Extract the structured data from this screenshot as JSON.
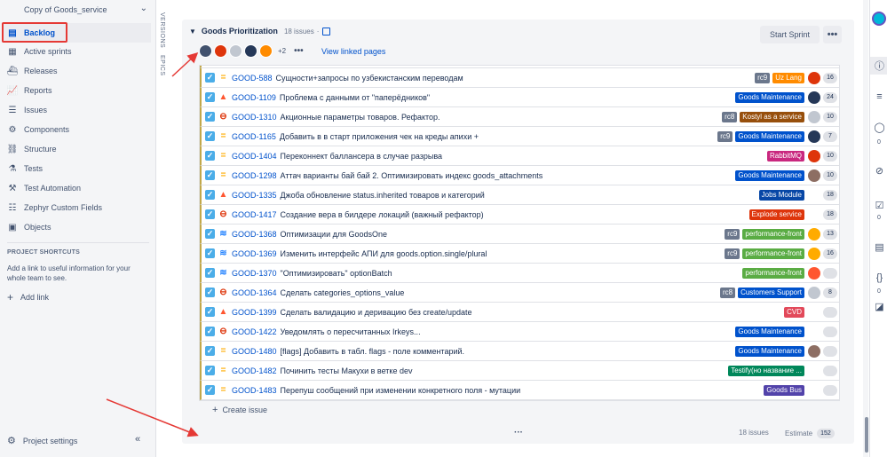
{
  "sidebar": {
    "project_name": "Copy of Goods_service",
    "items": [
      {
        "label": "Backlog",
        "icon": "backlog-icon",
        "glyph": "▤",
        "active": true
      },
      {
        "label": "Active sprints",
        "icon": "board-icon",
        "glyph": "▦",
        "active": false
      },
      {
        "label": "Releases",
        "icon": "ship-icon",
        "glyph": "⛴",
        "active": false
      },
      {
        "label": "Reports",
        "icon": "chart-icon",
        "glyph": "📈",
        "active": false
      },
      {
        "label": "Issues",
        "icon": "issues-icon",
        "glyph": "☰",
        "active": false
      },
      {
        "label": "Components",
        "icon": "components-icon",
        "glyph": "⚙",
        "active": false
      },
      {
        "label": "Structure",
        "icon": "structure-icon",
        "glyph": "⛓",
        "active": false
      },
      {
        "label": "Tests",
        "icon": "flask-icon",
        "glyph": "⚗",
        "active": false
      },
      {
        "label": "Test Automation",
        "icon": "automation-icon",
        "glyph": "⚒",
        "active": false
      },
      {
        "label": "Zephyr Custom Fields",
        "icon": "zephyr-icon",
        "glyph": "☷",
        "active": false
      },
      {
        "label": "Objects",
        "icon": "objects-icon",
        "glyph": "▣",
        "active": false
      }
    ],
    "shortcuts_title": "PROJECT SHORTCUTS",
    "shortcuts_help": "Add a link to useful information for your whole team to see.",
    "add_link": "Add link",
    "settings": "Project settings",
    "collapse": "«"
  },
  "vtabs": {
    "versions": "VERSIONS",
    "epics": "EPICS"
  },
  "sprint": {
    "title": "Goods Prioritization",
    "count": "18 issues",
    "separator": "·",
    "start_label": "Start Sprint",
    "more_label": "•••",
    "avatars_more": "+2",
    "avatars_dots": "•••",
    "linked_pages": "View linked pages",
    "create_issue": "Create issue",
    "footer_count": "18 issues",
    "footer_estimate_label": "Estimate",
    "footer_estimate_value": "152",
    "avatar_colors": [
      "#42526e",
      "#de350b",
      "#c1c7d0",
      "#253858",
      "#ff8b00"
    ]
  },
  "colors": {
    "rc": "#6b778c",
    "goods_maintenance": "#0052cc",
    "uz_lang": "#ff8b00",
    "kostyl": "#974f0c",
    "rabbitmq": "#c9287f",
    "jobs_module": "#0747a6",
    "explode_service": "#de350b",
    "performance_front": "#5aac44",
    "customers_support": "#0052cc",
    "cvd": "#e2495a",
    "testify": "#00875a",
    "goods_bus": "#5243aa"
  },
  "issues": [
    {
      "key": "GOOD-588",
      "summary": "Сущности+запросы по узбекистанским переводам",
      "prio": "medium",
      "prio_glyph": "=",
      "type": "story",
      "type_glyph": "✓",
      "labels": [
        {
          "text": "rc9",
          "rc": true
        },
        {
          "text": "Uz Lang",
          "color": "#ff8b00"
        }
      ],
      "avatar": "#de350b",
      "estimate": "16"
    },
    {
      "key": "GOOD-1109",
      "summary": "Проблема с данными от \"паперёдников\"",
      "prio": "highest",
      "prio_glyph": "▲",
      "type": "story",
      "type_glyph": "✓",
      "labels": [
        {
          "text": "Goods Maintenance",
          "color": "#0052cc"
        }
      ],
      "avatar": "#253858",
      "estimate": "24"
    },
    {
      "key": "GOOD-1310",
      "summary": "Акционные параметры товаров. Рефактор.",
      "prio": "blocker",
      "prio_glyph": "⊖",
      "type": "story",
      "type_glyph": "✓",
      "labels": [
        {
          "text": "rc8",
          "rc": true
        },
        {
          "text": "Kostyl as a service",
          "color": "#974f0c"
        }
      ],
      "avatar": "#c1c7d0",
      "estimate": "10"
    },
    {
      "key": "GOOD-1165",
      "summary": "Добавить в в старт приложения чек на креды апихи +",
      "prio": "medium",
      "prio_glyph": "=",
      "type": "story",
      "type_glyph": "✓",
      "labels": [
        {
          "text": "rc9",
          "rc": true
        },
        {
          "text": "Goods Maintenance",
          "color": "#0052cc"
        }
      ],
      "avatar": "#253858",
      "estimate": "7"
    },
    {
      "key": "GOOD-1404",
      "summary": "Переконнект баллансера в случае разрыва",
      "prio": "medium",
      "prio_glyph": "=",
      "type": "story",
      "type_glyph": "✓",
      "labels": [
        {
          "text": "RabbitMQ",
          "color": "#c9287f"
        }
      ],
      "avatar": "#de350b",
      "estimate": "10"
    },
    {
      "key": "GOOD-1298",
      "summary": "Аттач варианты бай бай 2. Оптимизировать индекс goods_attachments",
      "prio": "medium",
      "prio_glyph": "=",
      "type": "story",
      "type_glyph": "✓",
      "labels": [
        {
          "text": "Goods Maintenance",
          "color": "#0052cc"
        }
      ],
      "avatar": "#8d6e63",
      "estimate": "10"
    },
    {
      "key": "GOOD-1335",
      "summary": "Джоба обновление status.inherited товаров и категорий",
      "prio": "highest",
      "prio_glyph": "▲",
      "type": "story",
      "type_glyph": "✓",
      "labels": [
        {
          "text": "Jobs Module",
          "color": "#0747a6"
        }
      ],
      "avatar": "",
      "estimate": "18"
    },
    {
      "key": "GOOD-1417",
      "summary": "Создание вера в билдере локаций (важный рефактор)",
      "prio": "blocker",
      "prio_glyph": "⊖",
      "type": "story",
      "type_glyph": "✓",
      "labels": [
        {
          "text": "Explode service",
          "color": "#de350b"
        }
      ],
      "avatar": "",
      "estimate": "18"
    },
    {
      "key": "GOOD-1368",
      "summary": "Оптимизации для GoodsOne",
      "prio": "low",
      "prio_glyph": "≋",
      "type": "story",
      "type_glyph": "✓",
      "labels": [
        {
          "text": "rc9",
          "rc": true
        },
        {
          "text": "performance-front",
          "color": "#5aac44"
        }
      ],
      "avatar": "#ffab00",
      "estimate": "13"
    },
    {
      "key": "GOOD-1369",
      "summary": "Изменить интерфейс АПИ для goods.option.single/plural",
      "prio": "low",
      "prio_glyph": "≋",
      "type": "story",
      "type_glyph": "✓",
      "labels": [
        {
          "text": "rc9",
          "rc": true
        },
        {
          "text": "performance-front",
          "color": "#5aac44"
        }
      ],
      "avatar": "#ffab00",
      "estimate": "16"
    },
    {
      "key": "GOOD-1370",
      "summary": "\"Оптимизировать\" optionBatch",
      "prio": "low",
      "prio_glyph": "≋",
      "type": "story",
      "type_glyph": "✓",
      "labels": [
        {
          "text": "performance-front",
          "color": "#5aac44"
        }
      ],
      "avatar": "#ff5630",
      "estimate": ""
    },
    {
      "key": "GOOD-1364",
      "summary": "Сделать categories_options_value",
      "prio": "blocker",
      "prio_glyph": "⊖",
      "type": "story",
      "type_glyph": "✓",
      "labels": [
        {
          "text": "rc8",
          "rc": true
        },
        {
          "text": "Customers Support",
          "color": "#0052cc"
        }
      ],
      "avatar": "#c1c7d0",
      "estimate": "8"
    },
    {
      "key": "GOOD-1399",
      "summary": "Сделать валидацию и деривацию без create/update",
      "prio": "highest",
      "prio_glyph": "▲",
      "type": "story",
      "type_glyph": "✓",
      "labels": [
        {
          "text": "CVD",
          "color": "#e2495a"
        }
      ],
      "avatar": "",
      "estimate": ""
    },
    {
      "key": "GOOD-1422",
      "summary": "Уведомлять о пересчитанных Irkeys...",
      "prio": "blocker",
      "prio_glyph": "⊖",
      "type": "story",
      "type_glyph": "✓",
      "labels": [
        {
          "text": "Goods Maintenance",
          "color": "#0052cc"
        }
      ],
      "avatar": "",
      "estimate": ""
    },
    {
      "key": "GOOD-1480",
      "summary": "[flags] Добавить в табл. flags - поле комментарий.",
      "prio": "medium",
      "prio_glyph": "=",
      "type": "story",
      "type_glyph": "✓",
      "labels": [
        {
          "text": "Goods Maintenance",
          "color": "#0052cc"
        }
      ],
      "avatar": "#8d6e63",
      "estimate": ""
    },
    {
      "key": "GOOD-1482",
      "summary": "Починить тесты Макухи в ветке dev",
      "prio": "medium",
      "prio_glyph": "=",
      "type": "story",
      "type_glyph": "✓",
      "labels": [
        {
          "text": "Testify(но название ...",
          "color": "#00875a"
        }
      ],
      "avatar": "",
      "estimate": ""
    },
    {
      "key": "GOOD-1483",
      "summary": "Перепуш сообщений при изменении конкретного поля - мутации",
      "prio": "medium",
      "prio_glyph": "=",
      "type": "story",
      "type_glyph": "✓",
      "labels": [
        {
          "text": "Goods Bus",
          "color": "#5243aa"
        }
      ],
      "avatar": "",
      "estimate": ""
    }
  ],
  "rail": {
    "info_glyph": "ⓘ",
    "comments_glyph": "≡",
    "comments2_glyph": "◯",
    "comments2_count": "0",
    "attach_glyph": "⊘",
    "checklist_glyph": "☑",
    "checklist_count": "0",
    "forms_glyph": "▤",
    "code_glyph": "{}",
    "code_count": "0"
  }
}
